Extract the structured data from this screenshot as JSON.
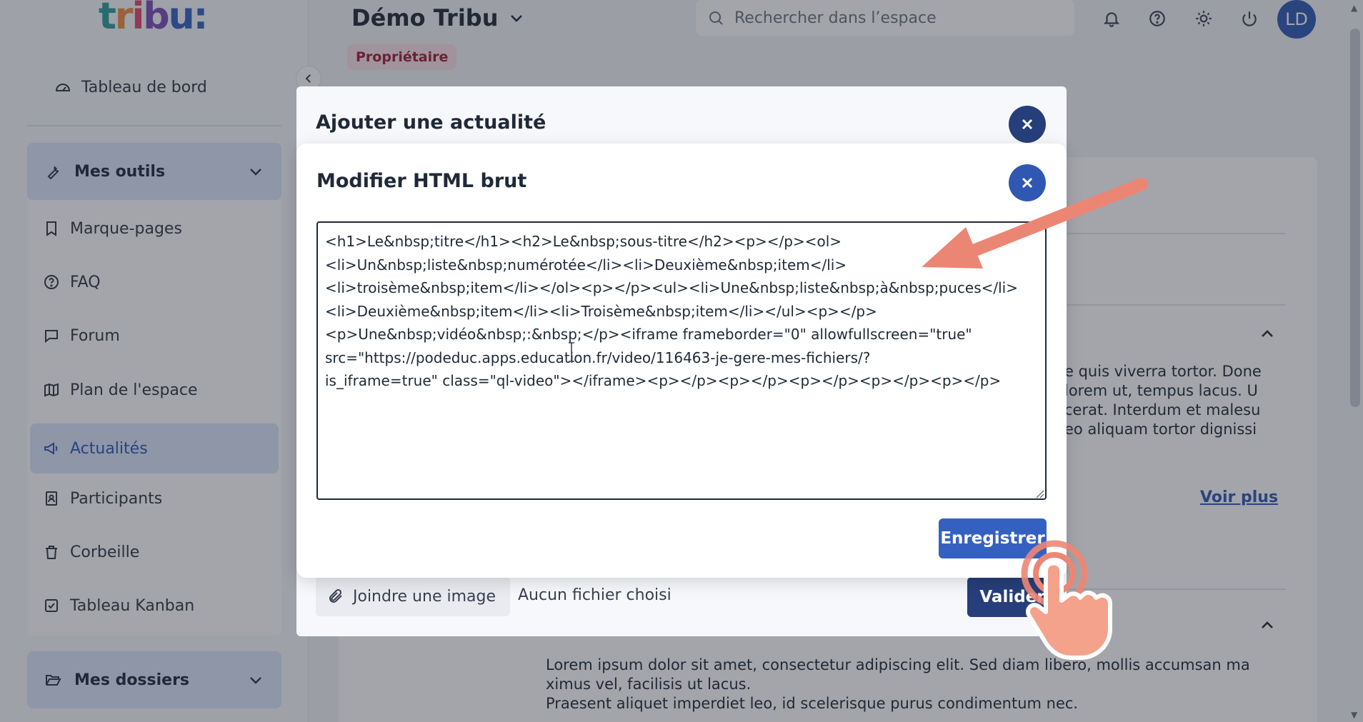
{
  "sidebar": {
    "logo_parts": [
      "t",
      "r",
      "i",
      "b",
      "u:"
    ],
    "dashboard": "Tableau de bord",
    "tools_group": "Mes outils",
    "items": [
      {
        "label": "Marque-pages",
        "icon": "bookmark-icon"
      },
      {
        "label": "FAQ",
        "icon": "help-circle-icon"
      },
      {
        "label": "Forum",
        "icon": "chat-bubble-icon"
      },
      {
        "label": "Plan de l'espace",
        "icon": "map-icon"
      },
      {
        "label": "Actualités",
        "icon": "megaphone-icon",
        "active": true
      },
      {
        "label": "Participants",
        "icon": "contact-book-icon"
      },
      {
        "label": "Corbeille",
        "icon": "trash-icon"
      },
      {
        "label": "Tableau Kanban",
        "icon": "checkbox-icon"
      }
    ],
    "folders_group": "Mes dossiers"
  },
  "header": {
    "space_title": "Démo Tribu",
    "role_badge": "Propriétaire",
    "search_placeholder": "Rechercher dans l’espace",
    "avatar_initials": "LD"
  },
  "background": {
    "lorem_right": "e quis viverra tortor. Done\nlorem ut, tempus lacus. U\ncerat. Interdum et malesu\neo aliquam tortor dignissi",
    "voir_plus": "Voir plus",
    "lorem_bottom_1": "Lorem ipsum dolor sit amet, consectetur adipiscing elit. Sed diam libero, mollis accumsan ma",
    "lorem_bottom_2": "ximus vel, facilisis ut lacus.",
    "lorem_bottom_3": "Praesent aliquet imperdiet leo, id scelerisque purus condimentum nec."
  },
  "outer_modal": {
    "title": "Ajouter une actualité",
    "attach_label": "Joindre une image",
    "no_file": "Aucun fichier choisi",
    "submit_label": "Valider"
  },
  "inner_modal": {
    "title": "Modifier HTML brut",
    "html_content": "<h1>Le&nbsp;titre</h1><h2>Le&nbsp;sous-titre</h2><p></p><ol>\n<li>Un&nbsp;liste&nbsp;numérotée</li><li>Deuxième&nbsp;item</li>\n<li>troisème&nbsp;item</li></ol><p></p><ul><li>Une&nbsp;liste&nbsp;à&nbsp;puces</li>\n<li>Deuxième&nbsp;item</li><li>Troisème&nbsp;item</li></ul><p></p>\n<p>Une&nbsp;vidéo&nbsp;:&nbsp;</p><iframe frameborder=\"0\" allowfullscreen=\"true\"\nsrc=\"https://podeduc.apps.education.fr/video/116463-je-gere-mes-fichiers/?\nis_iframe=true\" class=\"ql-video\"></iframe><p></p><p></p><p></p><p></p><p></p>",
    "save_label": "Enregistrer"
  },
  "colors": {
    "primary": "#3461c1",
    "primary_dark": "#263f7a",
    "active_bg": "#dbe5fb",
    "badge_bg": "#fbe1e6",
    "badge_text": "#9d1d3b",
    "annotation": "#ec8674"
  }
}
